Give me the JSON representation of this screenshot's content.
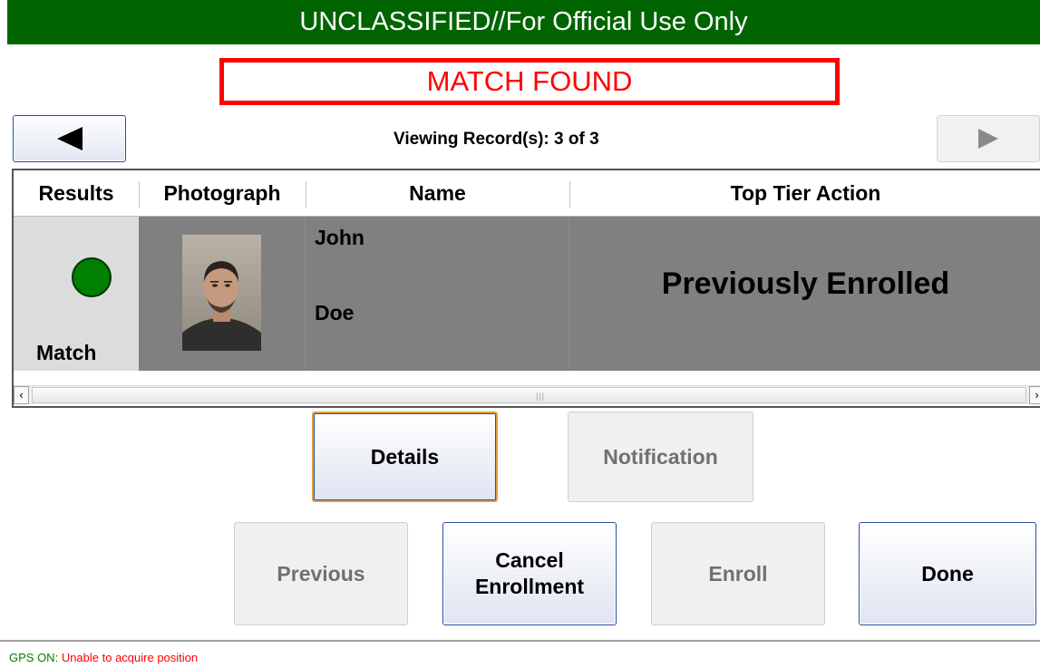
{
  "banner": {
    "text": "UNCLASSIFIED//For Official Use Only"
  },
  "match_status": "MATCH FOUND",
  "nav": {
    "prev_icon": "triangle-left",
    "next_icon": "triangle-right"
  },
  "viewing": {
    "text": "Viewing Record(s):  3 of 3"
  },
  "table": {
    "columns": [
      "Results",
      "Photograph",
      "Name",
      "Top Tier Action"
    ],
    "row": {
      "result_label": "Match",
      "result_color": "#008000",
      "first_name": "John",
      "last_name": "Doe",
      "action": "Previously Enrolled"
    }
  },
  "buttons": {
    "details": "Details",
    "notification": "Notification",
    "previous": "Previous",
    "cancel_line1": "Cancel",
    "cancel_line2": "Enrollment",
    "enroll": "Enroll",
    "done": "Done"
  },
  "status": {
    "gps_label": "GPS ON:",
    "gps_message": "Unable to acquire position"
  },
  "colors": {
    "banner": "#006400",
    "alert": "#ff0000",
    "match": "#008000"
  }
}
